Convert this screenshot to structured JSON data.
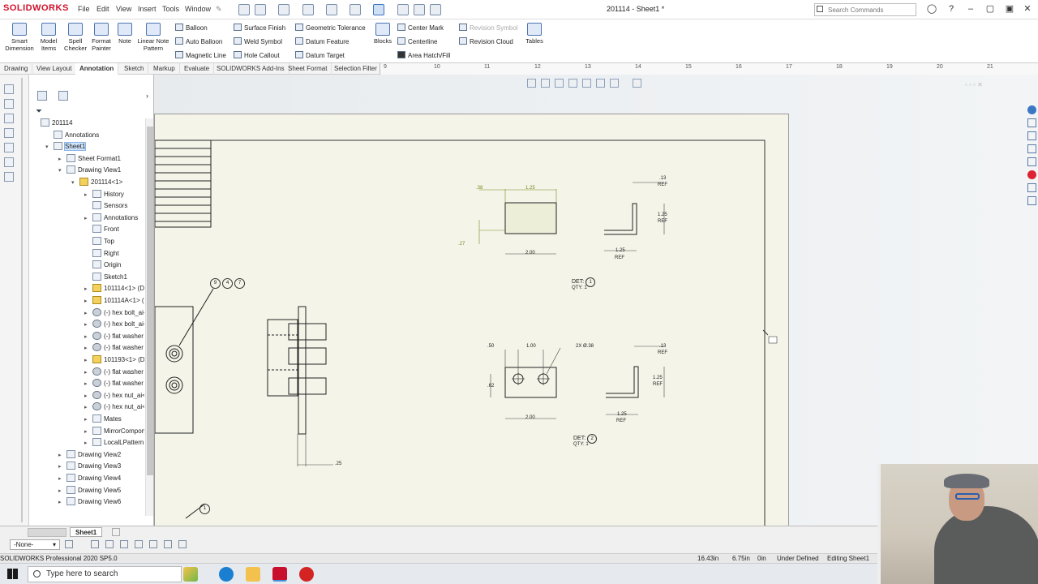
{
  "app": {
    "logo": "SOLIDWORKS",
    "doc_title": "201114 - Sheet1 *"
  },
  "menu": [
    "File",
    "Edit",
    "View",
    "Insert",
    "Tools",
    "Window"
  ],
  "search": {
    "placeholder": "Search Commands"
  },
  "ribbon": {
    "big": [
      {
        "id": "smart-dimension",
        "label": "Smart\nDimension"
      },
      {
        "id": "model-items",
        "label": "Model\nItems"
      },
      {
        "id": "spell-checker",
        "label": "Spell\nChecker"
      },
      {
        "id": "format-painter",
        "label": "Format\nPainter"
      },
      {
        "id": "note",
        "label": "Note"
      },
      {
        "id": "linear-note-pattern",
        "label": "Linear Note\nPattern"
      }
    ],
    "small": {
      "balloon": "Balloon",
      "auto_balloon": "Auto Balloon",
      "magnetic_line": "Magnetic Line",
      "surface_finish": "Surface Finish",
      "weld_symbol": "Weld Symbol",
      "hole_callout": "Hole Callout",
      "geometric_tolerance": "Geometric Tolerance",
      "datum_feature": "Datum Feature",
      "datum_target": "Datum Target",
      "blocks": "Blocks",
      "center_mark": "Center Mark",
      "centerline": "Centerline",
      "area_hatch": "Area Hatch/Fill",
      "revision_symbol": "Revision Symbol",
      "revision_cloud": "Revision Cloud",
      "tables": "Tables"
    }
  },
  "tabs": [
    "Drawing",
    "View Layout",
    "Annotation",
    "Sketch",
    "Markup",
    "Evaluate",
    "SOLIDWORKS Add-Ins",
    "Sheet Format",
    "Selection Filter"
  ],
  "active_tab": "Annotation",
  "ruler": [
    "9",
    "10",
    "11",
    "12",
    "13",
    "14",
    "15",
    "16",
    "17",
    "18",
    "19",
    "20",
    "21"
  ],
  "tree": [
    {
      "label": "201114",
      "indent": 0,
      "twisty": "",
      "icon": "doc"
    },
    {
      "label": "Annotations",
      "indent": 1,
      "twisty": "",
      "icon": "ann"
    },
    {
      "label": "Sheet1",
      "indent": 1,
      "twisty": "▾",
      "icon": "sheet",
      "selected": true
    },
    {
      "label": "Sheet Format1",
      "indent": 2,
      "twisty": "▸",
      "icon": "sheet"
    },
    {
      "label": "Drawing View1",
      "indent": 2,
      "twisty": "▾",
      "icon": "view"
    },
    {
      "label": "201114<1>",
      "indent": 3,
      "twisty": "▾",
      "icon": "part"
    },
    {
      "label": "History",
      "indent": 4,
      "twisty": "▸",
      "icon": "hist"
    },
    {
      "label": "Sensors",
      "indent": 4,
      "twisty": "",
      "icon": "sens"
    },
    {
      "label": "Annotations",
      "indent": 4,
      "twisty": "▸",
      "icon": "ann"
    },
    {
      "label": "Front",
      "indent": 4,
      "twisty": "",
      "icon": "plane"
    },
    {
      "label": "Top",
      "indent": 4,
      "twisty": "",
      "icon": "plane"
    },
    {
      "label": "Right",
      "indent": 4,
      "twisty": "",
      "icon": "plane"
    },
    {
      "label": "Origin",
      "indent": 4,
      "twisty": "",
      "icon": "origin"
    },
    {
      "label": "Sketch1",
      "indent": 4,
      "twisty": "",
      "icon": "sketch"
    },
    {
      "label": "101114<1> (Defa",
      "indent": 4,
      "twisty": "▸",
      "icon": "part"
    },
    {
      "label": "101114A<1> (Def",
      "indent": 4,
      "twisty": "▸",
      "icon": "part"
    },
    {
      "label": "(-) hex bolt_ai<1>",
      "indent": 4,
      "twisty": "▸",
      "icon": "fast"
    },
    {
      "label": "(-) hex bolt_ai<2>",
      "indent": 4,
      "twisty": "▸",
      "icon": "fast"
    },
    {
      "label": "(-) flat washer typ",
      "indent": 4,
      "twisty": "▸",
      "icon": "fast"
    },
    {
      "label": "(-) flat washer typ",
      "indent": 4,
      "twisty": "▸",
      "icon": "fast"
    },
    {
      "label": "101193<1> (Defa",
      "indent": 4,
      "twisty": "▸",
      "icon": "part"
    },
    {
      "label": "(-) flat washer typ",
      "indent": 4,
      "twisty": "▸",
      "icon": "fast"
    },
    {
      "label": "(-) flat washer typ",
      "indent": 4,
      "twisty": "▸",
      "icon": "fast"
    },
    {
      "label": "(-) hex nut_ai<1>",
      "indent": 4,
      "twisty": "▸",
      "icon": "fast"
    },
    {
      "label": "(-) hex nut_ai<2>",
      "indent": 4,
      "twisty": "▸",
      "icon": "fast"
    },
    {
      "label": "Mates",
      "indent": 4,
      "twisty": "▸",
      "icon": "mates"
    },
    {
      "label": "MirrorComponen",
      "indent": 4,
      "twisty": "▸",
      "icon": "mirror"
    },
    {
      "label": "LocalLPattern1",
      "indent": 4,
      "twisty": "▸",
      "icon": "pattern"
    },
    {
      "label": "Drawing View2",
      "indent": 2,
      "twisty": "▸",
      "icon": "view"
    },
    {
      "label": "Drawing View3",
      "indent": 2,
      "twisty": "▸",
      "icon": "view"
    },
    {
      "label": "Drawing View4",
      "indent": 2,
      "twisty": "▸",
      "icon": "view"
    },
    {
      "label": "Drawing View5",
      "indent": 2,
      "twisty": "▸",
      "icon": "view"
    },
    {
      "label": "Drawing View6",
      "indent": 2,
      "twisty": "▸",
      "icon": "view"
    }
  ],
  "drawing": {
    "balloons_top": [
      "9",
      "4",
      "7"
    ],
    "balloon_bottom": "1",
    "det1": {
      "label": "DET:",
      "num": "1",
      "qty": "QTY: 1"
    },
    "det2": {
      "label": "DET:",
      "num": "2",
      "qty": "QTY: 1"
    },
    "dims_top": {
      "d1": ".38",
      "d2": "1.25",
      "d3": ".27",
      "d4": "2.00"
    },
    "dims_angle_top": {
      "a1": ".13",
      "a1r": "REF",
      "a2": "1.25",
      "a2r": "REF",
      "a3": "1.25",
      "a3r": "REF"
    },
    "dims_bot": {
      "d1": ".50",
      "d2": "1.00",
      "d3": "2X Ø.38",
      "d4": ".62",
      "d5": "2.00"
    },
    "dims_angle_bot": {
      "a1": ".13",
      "a1r": "REF",
      "a2": "1.25",
      "a2r": "REF",
      "a3": "1.25",
      "a3r": "REF"
    },
    "dim_side": ".25"
  },
  "bottom": {
    "layer": "-None-",
    "sheet_tab": "Sheet1"
  },
  "status": {
    "product": "SOLIDWORKS Professional 2020 SP5.0",
    "x": "16.43in",
    "y": "6.75in",
    "z": "0in",
    "state": "Under Defined",
    "mode": "Editing Sheet1"
  },
  "taskbar": {
    "search_placeholder": "Type here to search"
  }
}
